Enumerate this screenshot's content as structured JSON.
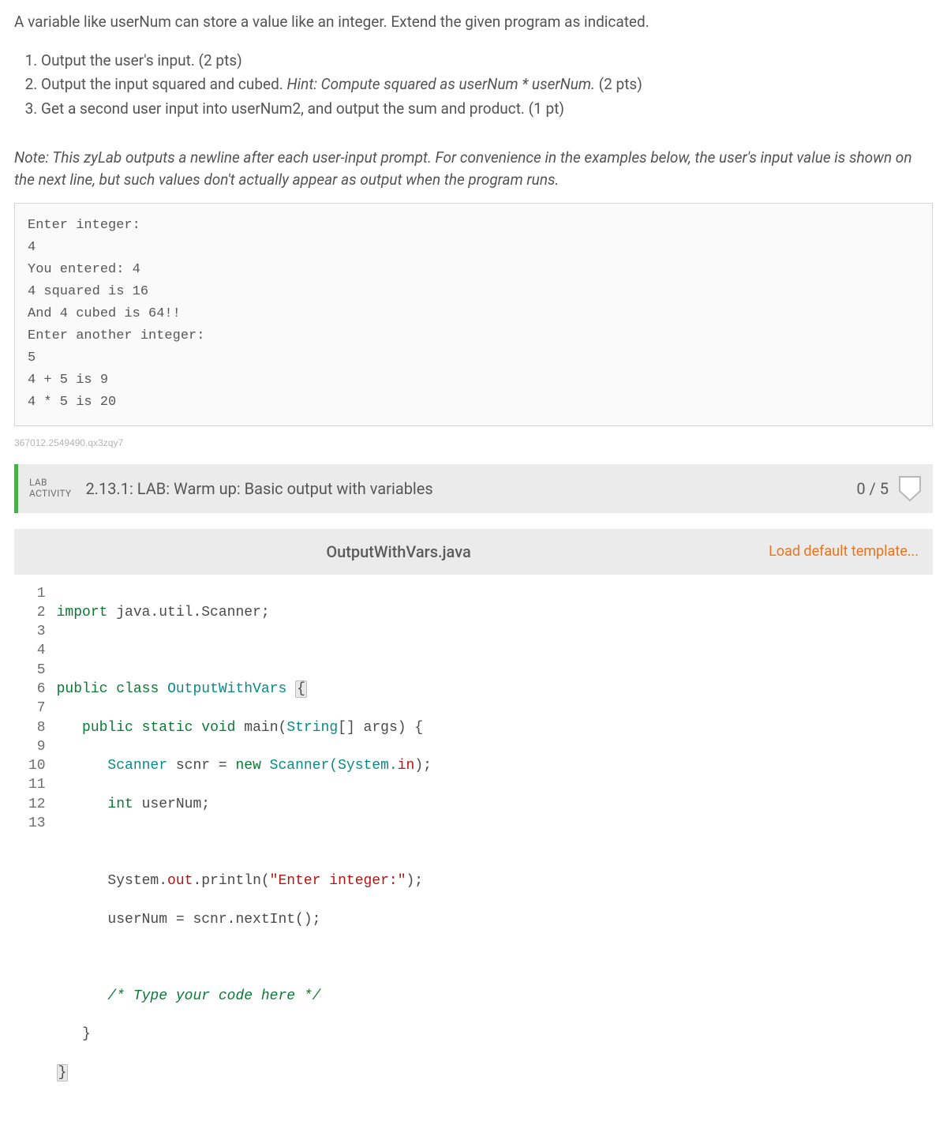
{
  "intro": "A variable like userNum can store a value like an integer. Extend the given program as indicated.",
  "steps": [
    {
      "text": "Output the user's input. (2 pts)",
      "hint": ""
    },
    {
      "text": "Output the input squared and cubed. ",
      "hint": "Hint: Compute squared as userNum * userNum.",
      "tail": " (2 pts)"
    },
    {
      "text": "Get a second user input into userNum2, and output the sum and product. (1 pt)",
      "hint": ""
    }
  ],
  "note": "Note: This zyLab outputs a newline after each user-input prompt. For convenience in the examples below, the user's input value is shown on the next line, but such values don't actually appear as output when the program runs.",
  "example_output": "Enter integer:\n4\nYou entered: 4\n4 squared is 16\nAnd 4 cubed is 64!!\nEnter another integer:\n5\n4 + 5 is 9\n4 * 5 is 20",
  "tracking_id": "367012.2549490.qx3zqy7",
  "activity": {
    "type_line1": "LAB",
    "type_line2": "ACTIVITY",
    "title": "2.13.1: LAB: Warm up: Basic output with variables",
    "score": "0 / 5"
  },
  "filebar": {
    "filename": "OutputWithVars.java",
    "load_template": "Load default template..."
  },
  "code": {
    "line_numbers": [
      "1",
      "2",
      "3",
      "4",
      "5",
      "6",
      "7",
      "8",
      "9",
      "10",
      "11",
      "12",
      "13"
    ],
    "l1": {
      "kw": "import",
      "pkg": " java.util.Scanner;"
    },
    "l3": {
      "kw1": "public",
      "kw2": "class",
      "cls": "OutputWithVars"
    },
    "l4": {
      "kw1": "public",
      "kw2": "static",
      "kw3": "void",
      "name": "main",
      "type": "String",
      "args": "[] args) {"
    },
    "l5": {
      "type1": "Scanner",
      "var": " scnr = ",
      "kw": "new",
      "type2": " Scanner(System.",
      "fld": "in",
      "end": ");"
    },
    "l6": {
      "kw": "int",
      "rest": " userNum;"
    },
    "l8": {
      "obj": "System.",
      "fld": "out",
      "call": ".println(",
      "str": "\"Enter integer:\"",
      "end": ");"
    },
    "l9": {
      "text": "userNum = scnr.nextInt();"
    },
    "l11": {
      "cmt": "/* Type your code here */"
    },
    "l12": {
      "text": "}"
    },
    "l13": {
      "text": "}"
    }
  }
}
